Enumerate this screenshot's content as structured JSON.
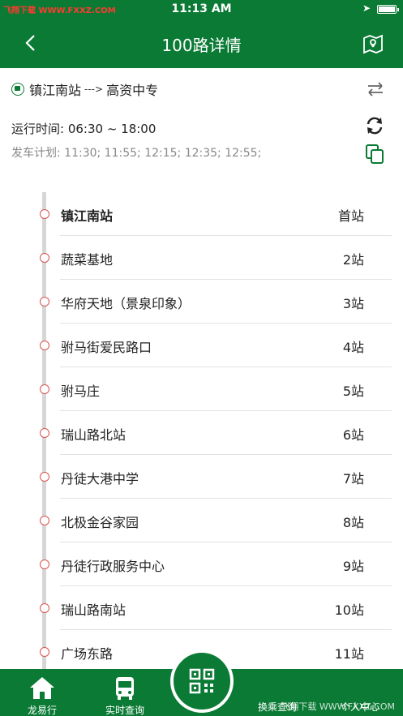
{
  "status_bar": {
    "carrier": "飞翔下载 WWW.FXXZ.COM",
    "time": "11:13 AM"
  },
  "header": {
    "title": "100路详情"
  },
  "route": {
    "from": "镇江南站",
    "arrow": "--->",
    "to": "高资中专",
    "run_time": "运行时间: 06:30 ~ 18:00",
    "plan": "发车计划: 11:30; 11:55; 12:15; 12:35; 12:55;"
  },
  "stops": [
    {
      "name": "镇江南站",
      "index": "首站"
    },
    {
      "name": "蔬菜基地",
      "index": "2站"
    },
    {
      "name": "华府天地（景泉印象）",
      "index": "3站"
    },
    {
      "name": "驸马街爱民路口",
      "index": "4站"
    },
    {
      "name": "驸马庄",
      "index": "5站"
    },
    {
      "name": "瑞山路北站",
      "index": "6站"
    },
    {
      "name": "丹徒大港中学",
      "index": "7站"
    },
    {
      "name": "北极金谷家园",
      "index": "8站"
    },
    {
      "name": "丹徒行政服务中心",
      "index": "9站"
    },
    {
      "name": "瑞山路南站",
      "index": "10站"
    },
    {
      "name": "广场东路",
      "index": "11站"
    }
  ],
  "tabs": {
    "home": "龙易行",
    "realtime": "实时查询",
    "transfer": "换乘查询",
    "personal": "个人中心"
  },
  "watermark": "飞翔下载 WWW.FXXZ.COM",
  "colors": {
    "primary": "#0a7a34",
    "stop_dot": "#d9534f"
  }
}
